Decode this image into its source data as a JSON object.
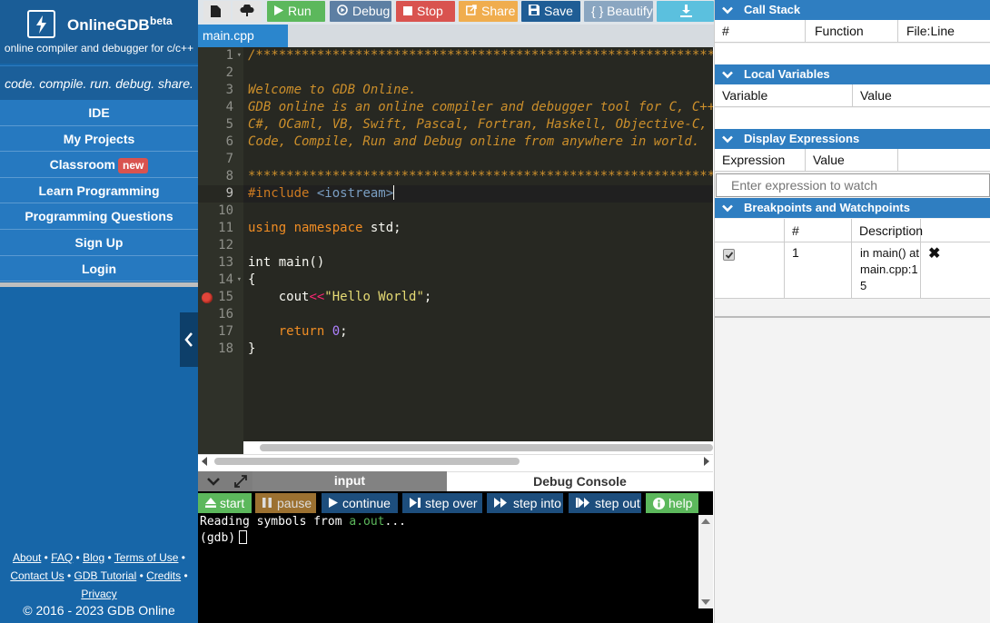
{
  "brand": {
    "name": "OnlineGDB",
    "beta": "beta",
    "subtitle": "online compiler and debugger for c/c++",
    "tagline": "code. compile. run. debug. share."
  },
  "nav": {
    "items": [
      {
        "label": "IDE"
      },
      {
        "label": "My Projects"
      },
      {
        "label": "Classroom",
        "badge": "new"
      },
      {
        "label": "Learn Programming"
      },
      {
        "label": "Programming Questions"
      },
      {
        "label": "Sign Up"
      },
      {
        "label": "Login"
      }
    ]
  },
  "footer": {
    "about": "About",
    "faq": "FAQ",
    "blog": "Blog",
    "terms": "Terms of Use",
    "contact": "Contact Us",
    "tutorial": "GDB Tutorial",
    "credits": "Credits",
    "privacy": "Privacy",
    "copyright": "© 2016 - 2023 GDB Online"
  },
  "toolbar": {
    "run": "Run",
    "debug": "Debug",
    "stop": "Stop",
    "share": "Share",
    "save": "Save",
    "beautify": "{ } Beautify"
  },
  "editor": {
    "file_tab": "main.cpp",
    "active_line": 9,
    "breakpoint_line": 15,
    "line_numbers": [
      "1",
      "2",
      "3",
      "4",
      "5",
      "6",
      "7",
      "8",
      "9",
      "10",
      "11",
      "12",
      "13",
      "14",
      "15",
      "16",
      "17",
      "18"
    ],
    "code": {
      "l1": "/******************************************************************************",
      "l3": "Welcome to GDB Online.",
      "l4": "GDB online is an online compiler and debugger tool for C, C++, Python, Java, PHP, Ruby, Perl,",
      "l5": "C#, OCaml, VB, Swift, Pascal, Fortran, Haskell, Objective-C, Assembly, HTML, CSS, JS, SQLite, Prolog.",
      "l6": "Code, Compile, Run and Debug online from anywhere in world.",
      "l8": "*******************************************************************************/",
      "l9_directive": "#include",
      "l9_header": "<iostream>",
      "l11_kw": "using namespace",
      "l11_rest": " std;",
      "l13": "int main()",
      "l14": "{",
      "l15_a": "    cout",
      "l15_op": "<<",
      "l15_str": "\"Hello World\"",
      "l15_end": ";",
      "l17_kw": "    return",
      "l17_num": "0",
      "l17_end": ";",
      "l18": "}"
    }
  },
  "bottom": {
    "tab_input": "input",
    "tab_debug": "Debug Console"
  },
  "debug_toolbar": {
    "start": "start",
    "pause": "pause",
    "continue": "continue",
    "step_over": "step over",
    "step_into": "step into",
    "step_out": "step out",
    "help": "help"
  },
  "console": {
    "line1_prefix": "Reading symbols from ",
    "line1_file": "a.out",
    "line1_suffix": "...",
    "prompt": "(gdb)"
  },
  "right_panel": {
    "call_stack": {
      "title": "Call Stack",
      "cols": [
        "#",
        "Function",
        "File:Line"
      ]
    },
    "local_vars": {
      "title": "Local Variables",
      "cols": [
        "Variable",
        "Value"
      ]
    },
    "display_expr": {
      "title": "Display Expressions",
      "cols": [
        "Expression",
        "Value"
      ],
      "placeholder": "Enter expression to watch"
    },
    "breakpoints": {
      "title": "Breakpoints and Watchpoints",
      "cols": [
        "#",
        "Description"
      ],
      "rows": [
        {
          "checked": true,
          "num": "1",
          "desc": "in main() at main.cpp:15"
        }
      ]
    }
  },
  "colors": {
    "sidebar": "#1766a8",
    "panel_header": "#2f7ec1",
    "run": "#5cb85c",
    "stop": "#d9534f",
    "share": "#f0ad4e",
    "editor_bg": "#272822"
  },
  "icons": [
    "bolt-logo-icon",
    "new-file-icon",
    "upload-icon",
    "play-icon",
    "debug-icon",
    "stop-icon",
    "share-icon",
    "save-icon",
    "download-icon",
    "chevron-left-icon",
    "chevron-down-icon",
    "expand-icon",
    "eject-icon",
    "pause-icon",
    "step-over-icon",
    "step-into-icon",
    "step-out-icon",
    "info-icon",
    "check-icon",
    "close-icon",
    "breakpoint-icon"
  ]
}
